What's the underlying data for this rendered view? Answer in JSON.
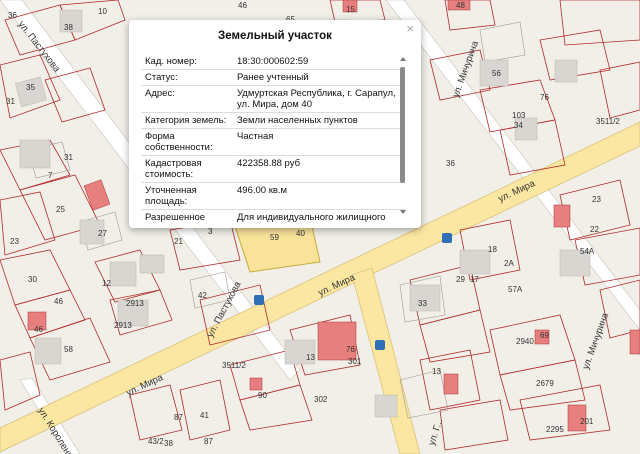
{
  "map": {
    "streets": {
      "pastukhova_top": "ул. Пастухова",
      "pastukhova_bottom": "ул. Пастухова",
      "michurina_top": "ул. Мичурина",
      "michurina_bottom": "ул. Мичурина",
      "mira_right": "ул. Мира",
      "mira_mid": "ул. Мира",
      "mira_left": "ул. Мира",
      "korolenko": "ул. Короленко",
      "gorkogo": "ул. Г..."
    },
    "quarter_labels": [
      "3511/2",
      "3511/2"
    ],
    "labels": [
      "36",
      "38",
      "10",
      "15",
      "31",
      "35",
      "48",
      "56",
      "76",
      "103",
      "34",
      "36",
      "31",
      "7",
      "25",
      "27",
      "23",
      "30",
      "46",
      "46",
      "58",
      "12",
      "2913",
      "2913",
      "42",
      "41",
      "87",
      "87",
      "43/2",
      "38",
      "13",
      "76",
      "301",
      "302",
      "90",
      "33",
      "57А",
      "18",
      "17",
      "29",
      "2А",
      "23",
      "54А",
      "22",
      "2940",
      "69",
      "2679",
      "2295",
      "201",
      "13",
      "40",
      "59",
      "21",
      "3",
      "65",
      "46"
    ]
  },
  "popup": {
    "title": "Земельный участок",
    "close": "×",
    "rows": [
      {
        "label": "Кад. номер:",
        "value": "18:30:000602:59"
      },
      {
        "label": "Статус:",
        "value": "Ранее учтенный"
      },
      {
        "label": "Адрес:",
        "value": "Удмуртская Республика, г. Сарапул, ул. Мира, дом 40"
      },
      {
        "label": "Категория земель:",
        "value": "Земли населенных пунктов"
      },
      {
        "label": "Форма собственности:",
        "value": "Частная"
      },
      {
        "label": "Кадастровая стоимость:",
        "value": "422358.88 руб"
      },
      {
        "label": "Уточненная площадь:",
        "value": "496.00 кв.м"
      },
      {
        "label": "Разрешенное",
        "value": "Для индивидуального жилищного"
      }
    ]
  },
  "colors": {
    "street_yellow": "#fbe7a1",
    "highlight": "#f9e39a",
    "parcel_red": "#b22a2a",
    "building": "#d9d6d2",
    "building_red": "#e87f7f",
    "bus_stop": "#2f6fb5"
  }
}
